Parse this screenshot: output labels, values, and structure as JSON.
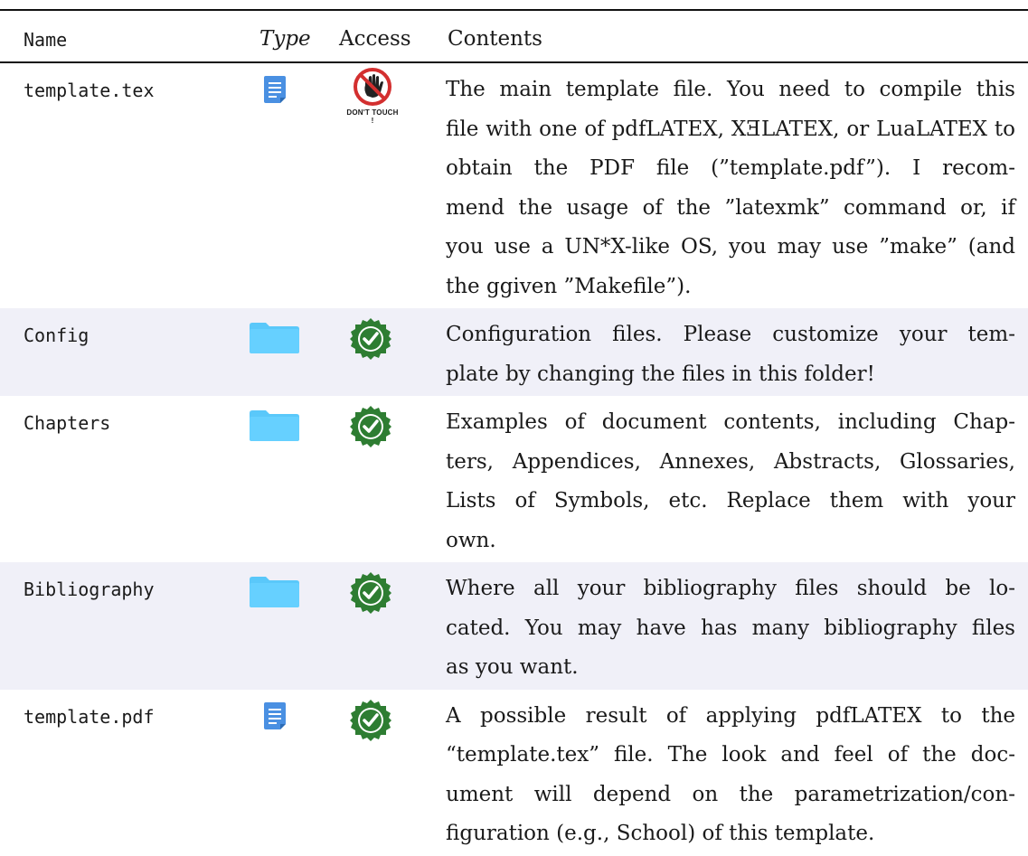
{
  "header": {
    "name": "Name",
    "type": "Type",
    "access": "Access",
    "contents": "Contents"
  },
  "rows": [
    {
      "name": "template.tex",
      "type_icon": "document-icon",
      "access_icon": "dont-touch-icon",
      "access_label": "DON'T TOUCH !",
      "lines": [
        "The main template file. You need to compile this",
        "file with one of pdfLATEX, XƎLATEX, or LuaLATEX to",
        "obtain the PDF file (”template.pdf”). I recom-",
        "mend the usage of the ”latexmk” command or, if",
        "you use a UN*X-like OS, you may use ”make” (and",
        "the ggiven ”Makefile”)."
      ]
    },
    {
      "name": "Config",
      "type_icon": "folder-icon",
      "access_icon": "allowed-access-icon",
      "access_label": "ALLOWED ACCESS",
      "lines": [
        "Configuration files. Please customize your tem-",
        "plate by changing the files in this folder!"
      ]
    },
    {
      "name": "Chapters",
      "type_icon": "folder-icon",
      "access_icon": "allowed-access-icon",
      "access_label": "ALLOWED ACCESS",
      "lines": [
        "Examples of document contents, including Chap-",
        "ters, Appendices, Annexes, Abstracts, Glossaries,",
        "Lists of Symbols, etc. Replace them with your",
        "own."
      ]
    },
    {
      "name": "Bibliography",
      "type_icon": "folder-icon",
      "access_icon": "allowed-access-icon",
      "access_label": "ALLOWED ACCESS",
      "lines": [
        "Where all your bibliography files should be lo-",
        "cated. You may have has many bibliography files",
        "as you want."
      ]
    },
    {
      "name": "template.pdf",
      "type_icon": "document-icon",
      "access_icon": "allowed-access-icon",
      "access_label": "ALLOWED ACCESS",
      "lines": [
        "A possible result of applying pdfLATEX to the",
        "“template.tex” file. The look and feel of the doc-",
        "ument will depend on the parametrization/con-",
        "figuration (e.g., School) of this template."
      ]
    }
  ],
  "colors": {
    "doc": "#4a90e2",
    "folder": "#5ac8fa",
    "allowed": "#2e7d32",
    "dont_touch": "#d32f2f",
    "row_shade": "#f0f0f8"
  }
}
